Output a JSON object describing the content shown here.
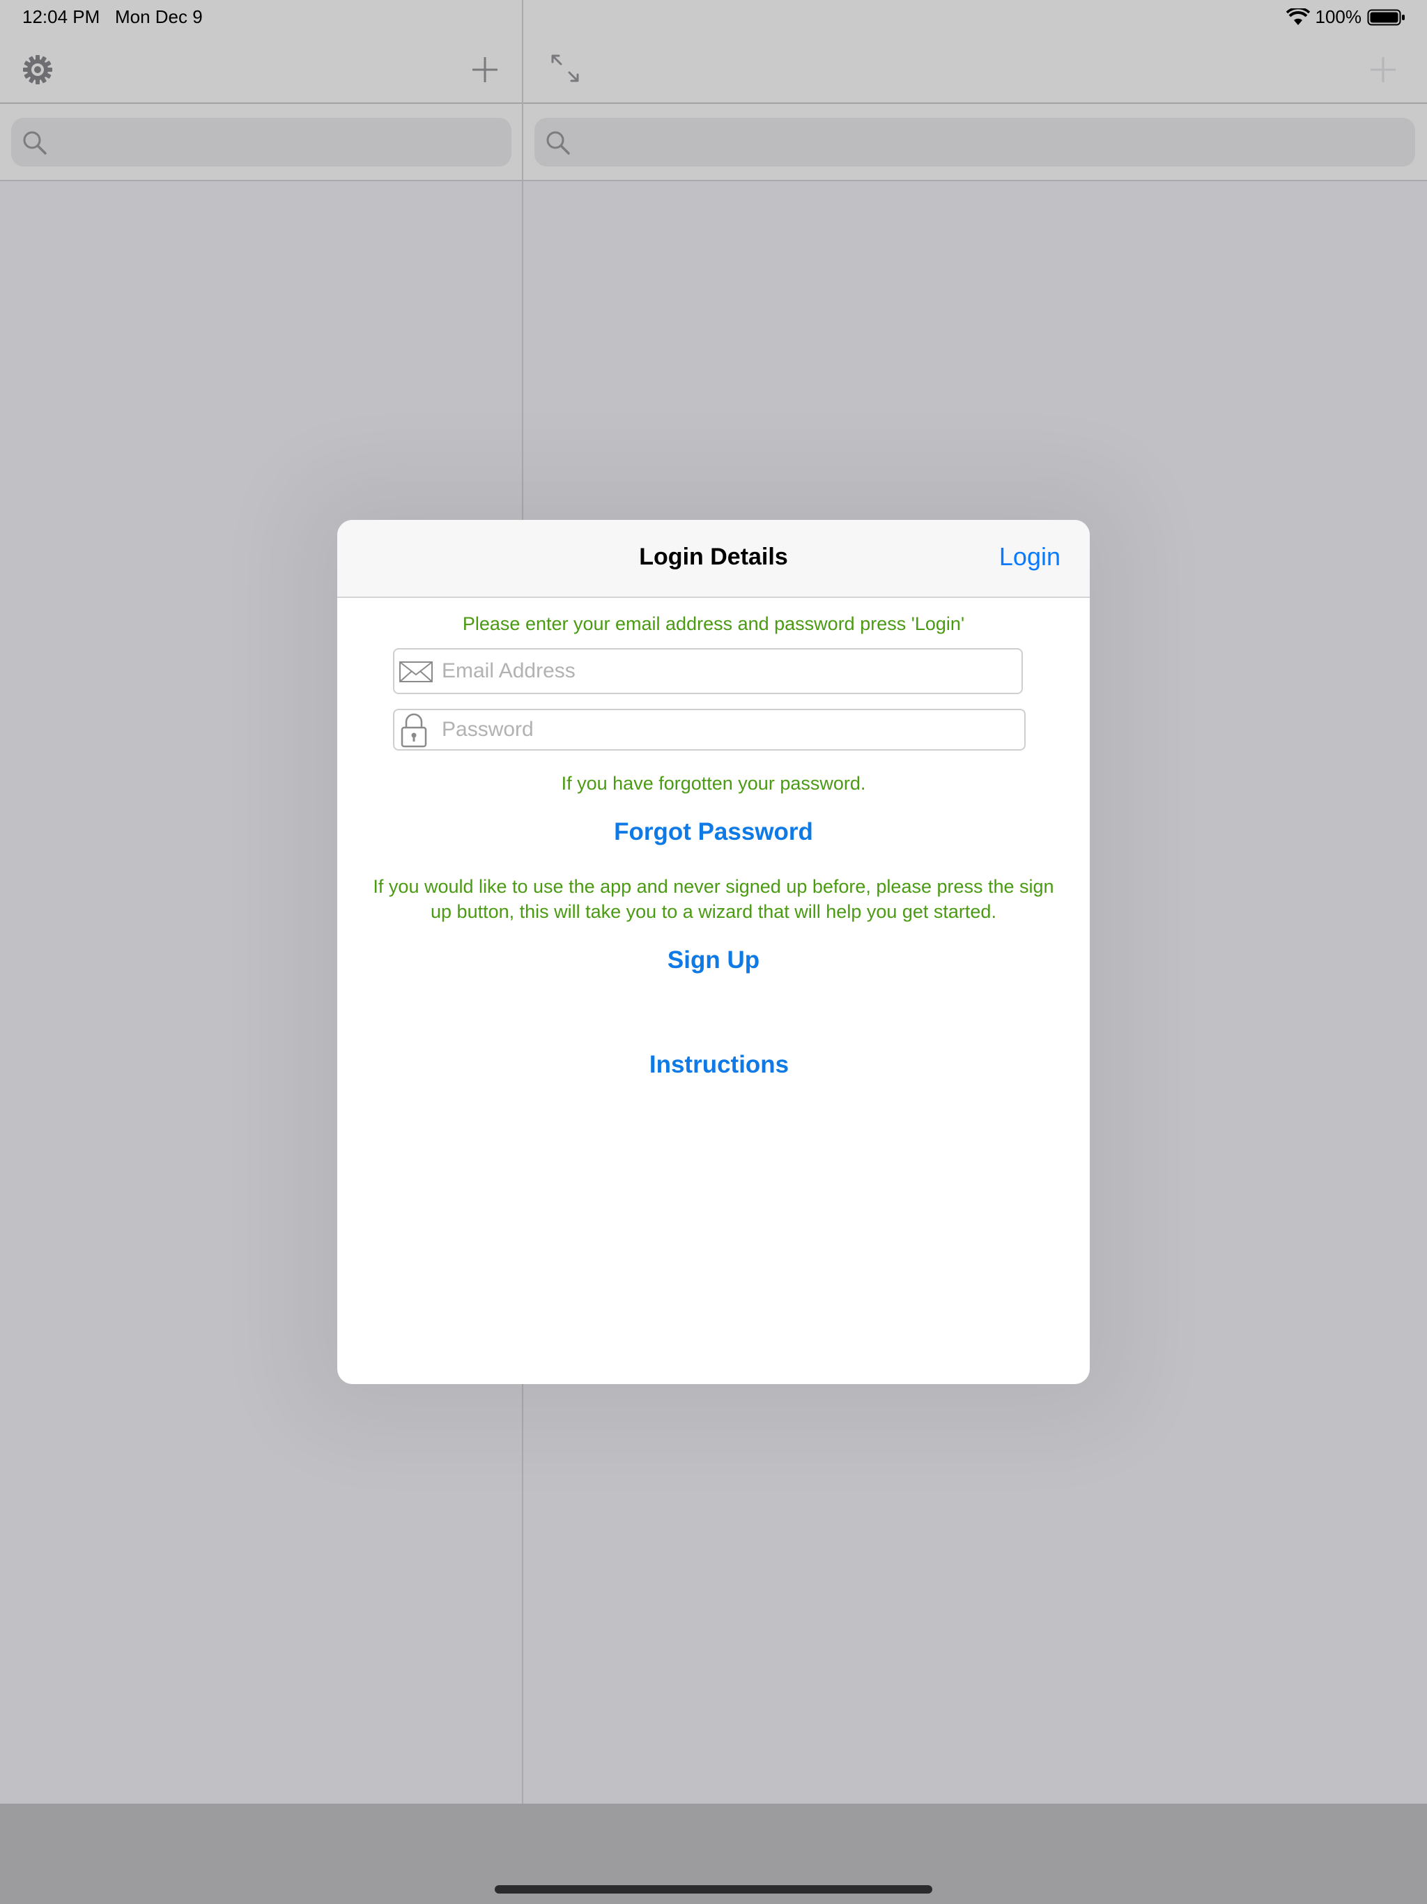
{
  "status_bar": {
    "time": "12:04 PM",
    "date": "Mon Dec 9",
    "battery": "100%",
    "wifi_icon": "wifi-icon",
    "battery_icon": "battery-icon"
  },
  "left_pane": {
    "settings_icon": "gear-icon",
    "add_icon": "plus-icon",
    "search": {
      "placeholder": "",
      "icon": "search-icon"
    }
  },
  "right_pane": {
    "expand_icon": "expand-icon",
    "add_icon": "plus-icon",
    "search": {
      "placeholder": "",
      "icon": "search-icon"
    }
  },
  "modal": {
    "title": "Login Details",
    "login_button": "Login",
    "instruction": "Please enter your email address and password press 'Login'",
    "email_field": {
      "placeholder": "Email Address",
      "value": "",
      "icon": "envelope-icon"
    },
    "password_field": {
      "placeholder": "Password",
      "value": "",
      "icon": "lock-icon"
    },
    "forgot_hint": "If you have forgotten your password.",
    "forgot_button": "Forgot Password",
    "signup_hint_line1": "If you would like to use the app and never signed up before, please press the sign",
    "signup_hint_line2": "up button, this will take you to a wizard that will help you get started.",
    "signup_button": "Sign Up",
    "instructions_button": "Instructions"
  },
  "colors": {
    "accent": "#0a7bff",
    "hint_green": "#4a9a12",
    "dim_background": "#c1c1c5"
  }
}
